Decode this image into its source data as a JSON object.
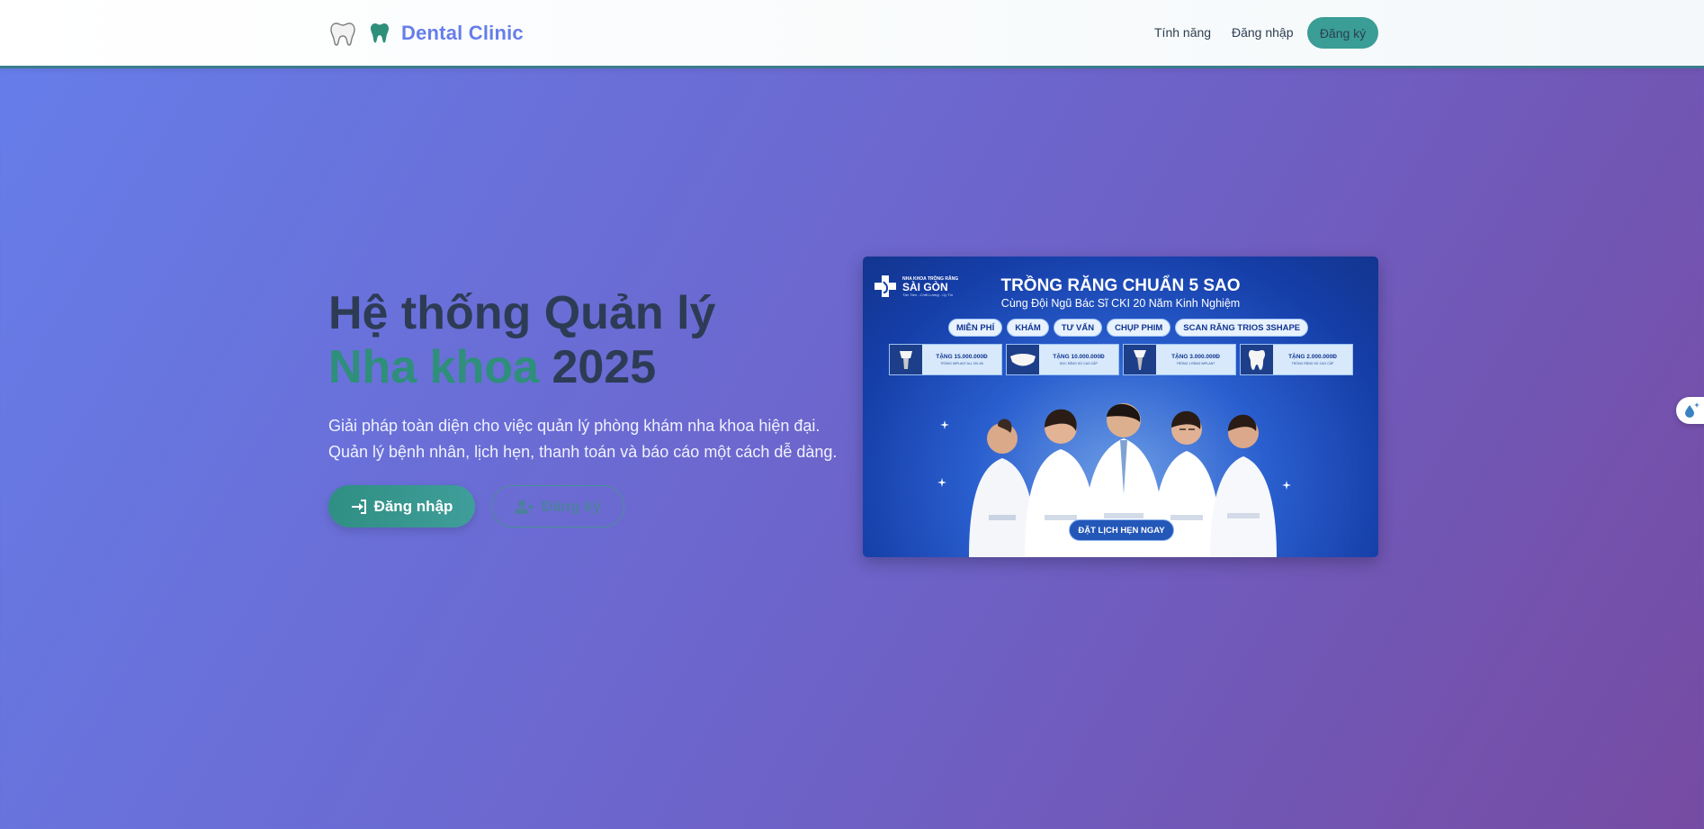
{
  "navbar": {
    "brand": "Dental Clinic",
    "logo_icon": "tooth-outline-icon",
    "brand_icon": "tooth-icon",
    "links": {
      "features": "Tính năng",
      "login": "Đăng nhập",
      "register": "Đăng ký"
    },
    "colors": {
      "brand": "#667eea",
      "accent": "#3a9d96"
    }
  },
  "hero": {
    "title_line1": "Hệ thống Quản lý",
    "title_accent": "Nha khoa",
    "title_year": "2025",
    "description_line1": "Giải pháp toàn diện cho việc quản lý phòng khám nha khoa hiện đại.",
    "description_line2": "Quản lý bệnh nhân, lịch hẹn, thanh toán và báo cáo một cách dễ dàng.",
    "login_button": "Đăng nhập",
    "login_icon": "sign-in-icon",
    "register_button": "Đăng ký",
    "register_icon": "user-plus-icon",
    "colors": {
      "title": "#2e3b55",
      "accent": "#2e8f7a"
    }
  },
  "banner": {
    "logo_small": "NHA KHOA TRỒNG RĂNG",
    "logo_big": "SÀI GÒN",
    "logo_tag": "Tận Tâm - Chất Lượng - Uy Tín",
    "title": "TRỒNG RĂNG CHUẨN 5 SAO",
    "subtitle": "Cùng Đội Ngũ Bác Sĩ CKI 20 Năm Kinh Nghiệm",
    "pills": [
      "MIỄN PHÍ",
      "KHÁM",
      "TƯ VẤN",
      "CHỤP PHIM",
      "SCAN RĂNG TRIOS 3SHAPE"
    ],
    "offers": [
      {
        "value": "TẶNG 15.000.000Đ",
        "note": "TRỒNG IMPLANT ALL ON 4/6"
      },
      {
        "value": "TẶNG 10.000.000Đ",
        "note": "BỌC RĂNG SỨ CAO CẤP"
      },
      {
        "value": "TẶNG 3.000.000Đ",
        "note": "TRỒNG 1 RĂNG IMPLANT"
      },
      {
        "value": "TẶNG 2.000.000Đ",
        "note": "TRỒNG RĂNG SỨ CAO CẤP"
      }
    ],
    "cta": "ĐẶT LỊCH HẸN NGAY"
  },
  "floating_widget": {
    "icon": "water-drop-sparkle-icon"
  }
}
